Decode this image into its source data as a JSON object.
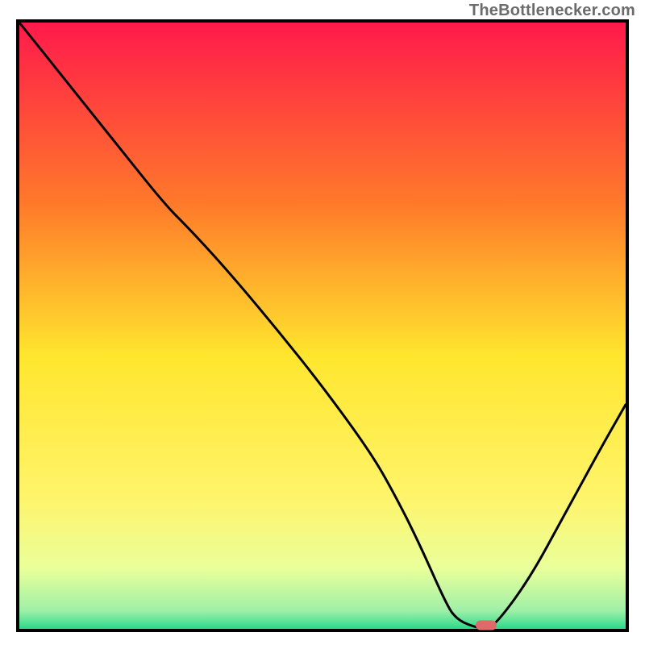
{
  "attribution": "TheBottlenecker.com",
  "chart_data": {
    "type": "line",
    "title": "",
    "xlabel": "",
    "ylabel": "",
    "xlim": [
      0,
      100
    ],
    "ylim": [
      0,
      100
    ],
    "gradient_colors": {
      "top": "#ff1a4b",
      "upper_mid": "#ff9a2a",
      "mid": "#ffe62e",
      "lower_mid": "#f7ff7a",
      "bottom": "#2bd98a"
    },
    "series": [
      {
        "name": "bottleneck-curve",
        "color": "#000000",
        "x": [
          0,
          8,
          16,
          24,
          28,
          34,
          42,
          50,
          58,
          62,
          66,
          70,
          72,
          76,
          78,
          84,
          90,
          96,
          100
        ],
        "y": [
          100,
          90,
          80,
          70,
          66,
          59.5,
          50,
          40,
          29,
          22,
          14,
          5,
          1.5,
          0,
          0,
          8,
          19,
          30,
          37
        ]
      }
    ],
    "marker": {
      "name": "optimal-point",
      "x": 77,
      "y": 0.6,
      "color": "#e06a6a",
      "shape": "rounded-rect"
    }
  }
}
